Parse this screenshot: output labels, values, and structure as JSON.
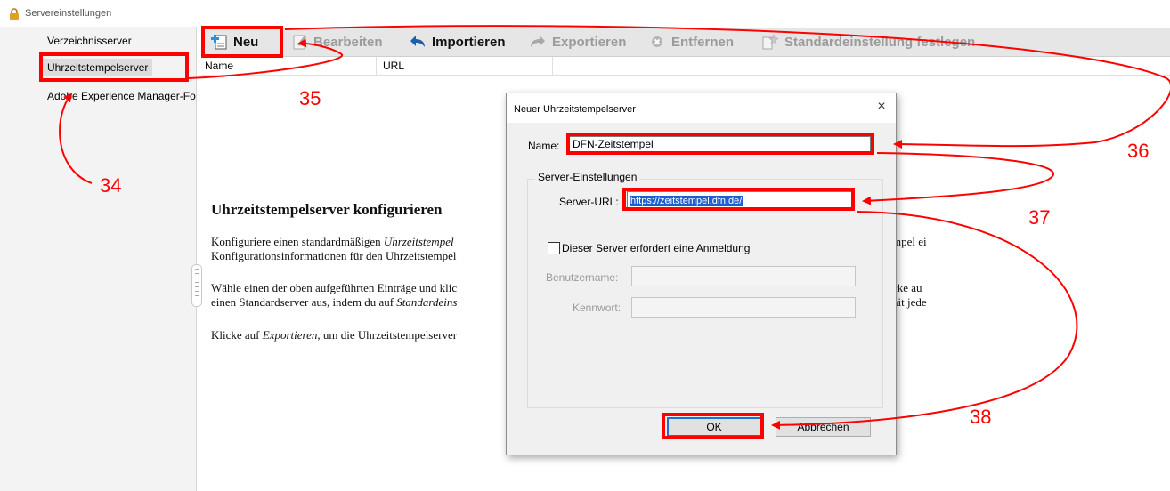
{
  "window": {
    "title": "Servereinstellungen"
  },
  "sidebar": {
    "items": [
      {
        "label": "Verzeichnisserver"
      },
      {
        "label": "Uhrzeitstempelserver"
      },
      {
        "label": "Adobe Experience Manager-Forms-Server"
      }
    ]
  },
  "toolbar": {
    "neu": "Neu",
    "bearbeiten": "Bearbeiten",
    "importieren": "Importieren",
    "exportieren": "Exportieren",
    "entfernen": "Entfernen",
    "standard": "Standardeinstellung festlegen"
  },
  "list": {
    "columns": [
      "Name",
      "URL"
    ]
  },
  "help": {
    "title": "Uhrzeitstempelserver konfigurieren",
    "p1_a": "Konfiguriere einen standardmäßigen ",
    "p1_em": "Uhrzeitstempel",
    "p1_b": "Konfigurationsinformationen für den Uhrzeitstempel",
    "p1_right": "mpel ei",
    "p2_a": "Wähle einen der oben aufgeführten Einträge und klic",
    "p2_b": "einen Standardserver aus, indem du auf ",
    "p2_em": "Standardeins",
    "p2_right1": "cke au",
    "p2_right2": "nit jede",
    "p3_a": "Klicke auf ",
    "p3_em": "Exportieren",
    "p3_b": ", um die Uhrzeitstempelserver"
  },
  "dialog": {
    "title": "Neuer Uhrzeitstempelserver",
    "close": "×",
    "name_label": "Name:",
    "name_value": "DFN-Zeitstempel",
    "group_label": "Server-Einstellungen",
    "url_label": "Server-URL:",
    "url_value": "https://zeitstempel.dfn.de/",
    "login_label": "Dieser Server erfordert eine Anmeldung",
    "user_label": "Benutzername:",
    "pass_label": "Kennwort:",
    "ok": "OK",
    "cancel": "Abbrechen"
  },
  "callouts": {
    "c34": "34",
    "c35": "35",
    "c36": "36",
    "c37": "37",
    "c38": "38"
  },
  "colors": {
    "annotation": "#ff0000",
    "selection": "#1e5fd0"
  }
}
